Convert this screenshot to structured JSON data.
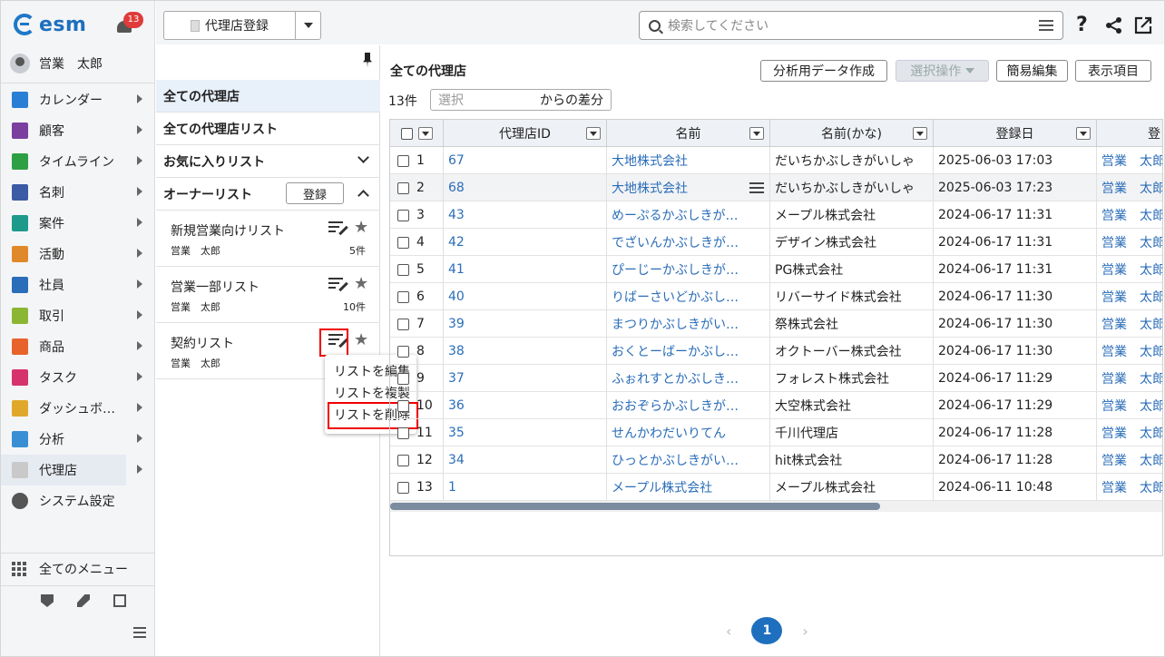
{
  "app": {
    "logo": "esm",
    "notifications": "13",
    "user": "営業　太郎"
  },
  "sidebar": {
    "items": [
      {
        "label": "カレンダー",
        "icon": "calendar-icon",
        "color": "#2a7fd4"
      },
      {
        "label": "顧客",
        "icon": "building-icon",
        "color": "#7b3fa0"
      },
      {
        "label": "タイムライン",
        "icon": "chat-icon",
        "color": "#2ea043"
      },
      {
        "label": "名刺",
        "icon": "card-icon",
        "color": "#3b5ba5"
      },
      {
        "label": "案件",
        "icon": "folder-icon",
        "color": "#1d9a8a"
      },
      {
        "label": "活動",
        "icon": "clipboard-icon",
        "color": "#e0892b"
      },
      {
        "label": "社員",
        "icon": "person-icon",
        "color": "#2a6db8"
      },
      {
        "label": "取引",
        "icon": "ledger-icon",
        "color": "#8bb634"
      },
      {
        "label": "商品",
        "icon": "box-icon",
        "color": "#e8622c"
      },
      {
        "label": "タスク",
        "icon": "check-icon",
        "color": "#d6336c"
      },
      {
        "label": "ダッシュボ…",
        "icon": "dashboard-icon",
        "color": "#e0a82b"
      },
      {
        "label": "分析",
        "icon": "chart-icon",
        "color": "#3a8fd4"
      },
      {
        "label": "代理店",
        "icon": "agency-icon",
        "color": "#c9c9c9"
      },
      {
        "label": "システム設定",
        "icon": "gear-icon",
        "color": "#555555"
      }
    ],
    "all_menu": "全てのメニュー"
  },
  "topbar": {
    "register_label": "代理店登録",
    "search_placeholder": "検索してください",
    "help": "?"
  },
  "listpanel": {
    "all_agencies": "全ての代理店",
    "all_lists": "全ての代理店リスト",
    "favorites": "お気に入りリスト",
    "owner_lists": "オーナーリスト",
    "register": "登録",
    "lists": [
      {
        "name": "新規営業向けリスト",
        "owner": "営業　太郎",
        "count": "5件"
      },
      {
        "name": "営業一部リスト",
        "owner": "営業　太郎",
        "count": "10件"
      },
      {
        "name": "契約リスト",
        "owner": "営業　太郎",
        "count": ""
      }
    ],
    "popup": [
      "リストを編集",
      "リストを複製",
      "リストを削除"
    ]
  },
  "main": {
    "title": "全ての代理店",
    "buttons": {
      "export": "分析用データ作成",
      "bulk": "選択操作",
      "quick_edit": "簡易編集",
      "columns": "表示項目"
    },
    "count": "13件",
    "diff_placeholder": "選択",
    "diff_suffix": "からの差分",
    "columns": [
      "代理店ID",
      "名前",
      "名前(かな)",
      "登録日",
      "登"
    ],
    "rows": [
      {
        "n": "1",
        "id": "67",
        "name": "大地株式会社",
        "kana": "だいちかぶしきがいしゃ",
        "date": "2025-06-03 17:03",
        "owner": "営業　太郎"
      },
      {
        "n": "2",
        "id": "68",
        "name": "大地株式会社",
        "kana": "だいちかぶしきがいしゃ",
        "date": "2025-06-03 17:23",
        "owner": "営業　太郎"
      },
      {
        "n": "3",
        "id": "43",
        "name": "めーぷるかぶしきが…",
        "kana": "メープル株式会社",
        "date": "2024-06-17 11:31",
        "owner": "営業　太郎"
      },
      {
        "n": "4",
        "id": "42",
        "name": "でざいんかぶしきが…",
        "kana": "デザイン株式会社",
        "date": "2024-06-17 11:31",
        "owner": "営業　太郎"
      },
      {
        "n": "5",
        "id": "41",
        "name": "ぴーじーかぶしきが…",
        "kana": "PG株式会社",
        "date": "2024-06-17 11:31",
        "owner": "営業　太郎"
      },
      {
        "n": "6",
        "id": "40",
        "name": "りばーさいどかぶし…",
        "kana": "リバーサイド株式会社",
        "date": "2024-06-17 11:30",
        "owner": "営業　太郎"
      },
      {
        "n": "7",
        "id": "39",
        "name": "まつりかぶしきがい…",
        "kana": "祭株式会社",
        "date": "2024-06-17 11:30",
        "owner": "営業　太郎"
      },
      {
        "n": "8",
        "id": "38",
        "name": "おくとーばーかぶし…",
        "kana": "オクトーバー株式会社",
        "date": "2024-06-17 11:30",
        "owner": "営業　太郎"
      },
      {
        "n": "9",
        "id": "37",
        "name": "ふぉれすとかぶしき…",
        "kana": "フォレスト株式会社",
        "date": "2024-06-17 11:29",
        "owner": "営業　太郎"
      },
      {
        "n": "10",
        "id": "36",
        "name": "おおぞらかぶしきが…",
        "kana": "大空株式会社",
        "date": "2024-06-17 11:29",
        "owner": "営業　太郎"
      },
      {
        "n": "11",
        "id": "35",
        "name": "せんかわだいりてん",
        "kana": "千川代理店",
        "date": "2024-06-17 11:28",
        "owner": "営業　太郎"
      },
      {
        "n": "12",
        "id": "34",
        "name": "ひっとかぶしきがい…",
        "kana": "hit株式会社",
        "date": "2024-06-17 11:28",
        "owner": "営業　太郎"
      },
      {
        "n": "13",
        "id": "1",
        "name": "メープル株式会社",
        "kana": "メープル株式会社",
        "date": "2024-06-11 10:48",
        "owner": "営業　太郎"
      }
    ],
    "page": "1"
  }
}
